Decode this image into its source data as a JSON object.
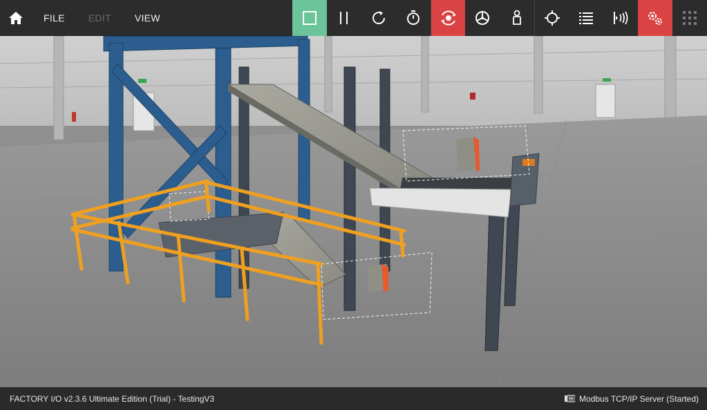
{
  "menu": {
    "file_label": "FILE",
    "edit_label": "EDIT",
    "view_label": "VIEW"
  },
  "toolbar": {
    "buttons": [
      {
        "name": "edit-mode-icon",
        "state": "active",
        "color": "#6cc49a"
      },
      {
        "name": "pause-icon"
      },
      {
        "name": "reset-icon"
      },
      {
        "name": "stopwatch-icon"
      },
      {
        "name": "camera-orbit-icon",
        "state": "active",
        "color": "#d94343"
      },
      {
        "name": "camera-fly-icon"
      },
      {
        "name": "camera-first-person-icon"
      },
      {
        "name": "target-icon"
      },
      {
        "name": "tag-list-icon"
      },
      {
        "name": "sensor-icon"
      },
      {
        "name": "drivers-icon",
        "state": "active",
        "color": "#d94343"
      },
      {
        "name": "grid-icon"
      }
    ]
  },
  "status": {
    "left_text": "FACTORY I/O v2.3.6 Ultimate Edition (Trial)  - TestingV3",
    "server_text": "Modbus TCP/IP Server (Started)"
  },
  "colors": {
    "toolbar_bg": "#2c2c2c",
    "accent_green": "#6cc49a",
    "accent_red": "#d94343",
    "frame_blue": "#2b5d8f",
    "rail_orange": "#f0a020"
  }
}
